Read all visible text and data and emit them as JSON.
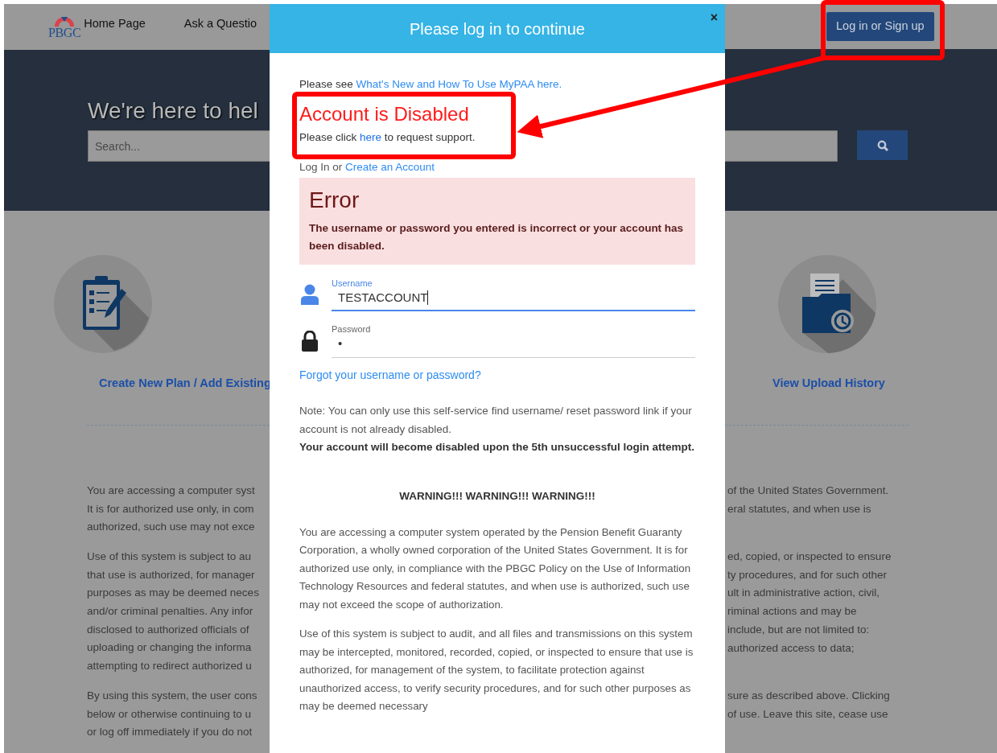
{
  "header": {
    "logo": "PBGC",
    "nav": [
      "Home Page",
      "Ask a Questio"
    ],
    "login_button": "Log in or Sign up"
  },
  "hero": {
    "title": "We're here to hel",
    "search_placeholder": "Search..."
  },
  "tiles": [
    {
      "kind": "clipboard",
      "label": "Create New Plan / Add Existing"
    },
    {
      "kind": "folder",
      "label": "View Upload History"
    }
  ],
  "background_text": {
    "left": [
      [
        "You are accessing a computer syst",
        "It is for authorized use only, in com",
        "authorized, such use may not exce"
      ],
      [
        "Use of this system is subject to au",
        "that use is authorized, for manager",
        "purposes as may be deemed neces",
        "and/or criminal penalties. Any infor",
        "disclosed to authorized officials of",
        "uploading or changing the informa",
        "attempting to redirect authorized u"
      ],
      [
        "By using this system, the user cons",
        "below or otherwise continuing to u",
        "or log off immediately if you do not"
      ]
    ],
    "right": [
      [
        "of the United States Government.",
        "eral statutes, and when use is"
      ],
      [
        "ed, copied, or inspected to ensure",
        "ty procedures, and for such other",
        "ult in administrative action, civil,",
        "riminal actions and may be",
        "include, but are not limited to:",
        "authorized access to data;"
      ],
      [
        "sure as described above. Clicking",
        "of use. Leave this site, cease use"
      ]
    ]
  },
  "modal": {
    "title": "Please log in to continue",
    "close": "×",
    "intro": {
      "text": "Please see ",
      "link": "What's New and How To Use MyPAA here."
    },
    "alert": {
      "title": "Account is Disabled",
      "text_before": "Please click ",
      "link": "here",
      "text_after": " to request support."
    },
    "login_line": {
      "text": "Log In or ",
      "link": "Create an Account"
    },
    "error": {
      "title": "Error",
      "message": "The username or password you entered is incorrect or your account has been disabled."
    },
    "fields": [
      {
        "kind": "username",
        "label": "Username",
        "value": "TESTACCOUNT",
        "focused": true
      },
      {
        "kind": "password",
        "label": "Password",
        "value": "•",
        "focused": false
      }
    ],
    "forgot_link": "Forgot your username or password?",
    "note": "Note: You can only use this self-service find username/ reset password link if your account is not already disabled.",
    "note_bold": "Your account will become disabled upon the 5th unsuccessful login attempt.",
    "warning": "WARNING!!! WARNING!!! WARNING!!!",
    "paragraphs": [
      "You are accessing a computer system operated by the Pension Benefit Guaranty Corporation, a wholly owned corporation of the United States Government. It is for authorized use only, in compliance with the PBGC Policy on the Use of Information Technology Resources and federal statutes, and when use is authorized, such use may not exceed the scope of authorization.",
      "Use of this system is subject to audit, and all files and transmissions on this system may be intercepted, monitored, recorded, copied, or inspected to ensure that use is authorized, for management of the system, to facilitate protection against unauthorized access, to verify security procedures, and for such other purposes as may be deemed necessary"
    ]
  }
}
